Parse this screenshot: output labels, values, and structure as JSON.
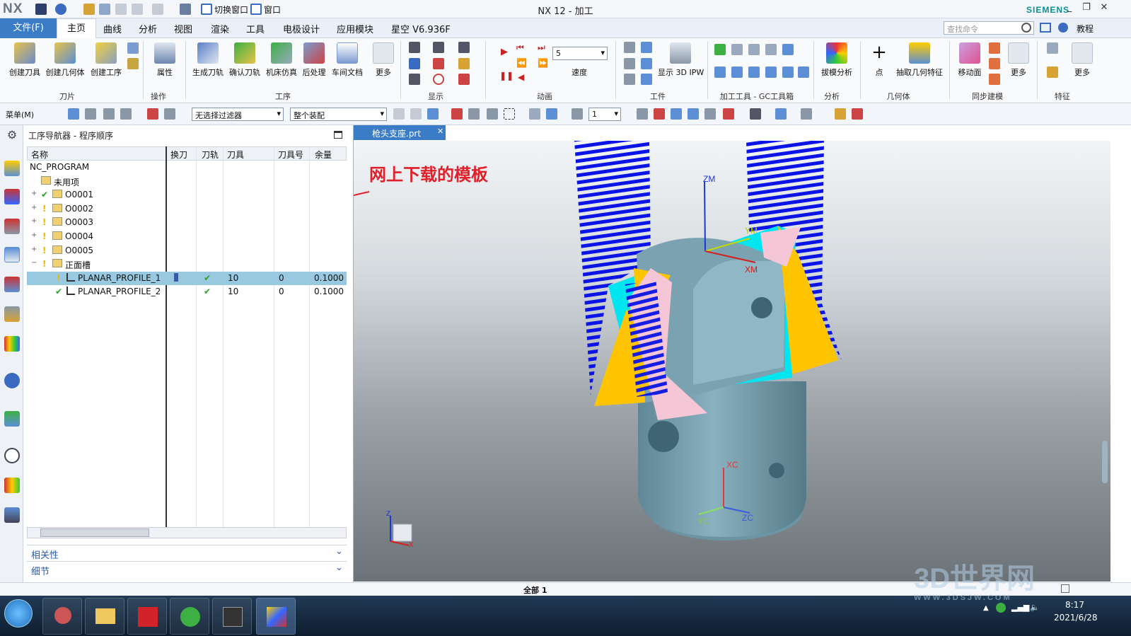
{
  "title_bar": {
    "logo": "NX",
    "switch_window": "切换窗口",
    "window_menu": "窗口",
    "app_title": "NX 12 - 加工",
    "brand": "SIEMENS"
  },
  "menu": {
    "file": "文件(F)",
    "tabs": [
      "主页",
      "曲线",
      "分析",
      "视图",
      "渲染",
      "工具",
      "电极设计",
      "应用模块",
      "星空 V6.936F"
    ],
    "search_placeholder": "查找命令",
    "tutorial": "教程"
  },
  "ribbon": {
    "buttons": [
      "创建刀具",
      "创建几何体",
      "创建工序",
      "属性",
      "生成刀轨",
      "确认刀轨",
      "机床仿真",
      "后处理",
      "车间文档",
      "更多",
      "速度",
      "显示 3D IPW",
      "拔模分析",
      "点",
      "抽取几何特征",
      "移动面",
      "更多",
      "更多"
    ],
    "groups": [
      "刀片",
      "操作",
      "工序",
      "显示",
      "动画",
      "工件",
      "加工工具 - GC工具箱",
      "分析",
      "几何体",
      "同步建模",
      "特征"
    ],
    "speed_value": "5"
  },
  "toolbar2": {
    "menu": "菜单(M)",
    "filter": "无选择过滤器",
    "assembly": "整个装配",
    "layer_value": "1"
  },
  "navigator": {
    "title": "工序导航器 - 程序顺序",
    "columns": [
      "名称",
      "换刀",
      "刀轨",
      "刀具",
      "刀具号",
      "余量"
    ],
    "rows": [
      {
        "name": "NC_PROGRAM",
        "change": "",
        "path": "",
        "tool": "",
        "tool_no": "",
        "stock": ""
      },
      {
        "name": "未用项",
        "change": "",
        "path": "",
        "tool": "",
        "tool_no": "",
        "stock": ""
      },
      {
        "name": "O0001",
        "change": "",
        "path": "",
        "tool": "",
        "tool_no": "",
        "stock": ""
      },
      {
        "name": "O0002",
        "change": "",
        "path": "",
        "tool": "",
        "tool_no": "",
        "stock": ""
      },
      {
        "name": "O0003",
        "change": "",
        "path": "",
        "tool": "",
        "tool_no": "",
        "stock": ""
      },
      {
        "name": "O0004",
        "change": "",
        "path": "",
        "tool": "",
        "tool_no": "",
        "stock": ""
      },
      {
        "name": "O0005",
        "change": "",
        "path": "",
        "tool": "",
        "tool_no": "",
        "stock": ""
      },
      {
        "name": "正面槽",
        "change": "",
        "path": "",
        "tool": "",
        "tool_no": "",
        "stock": ""
      },
      {
        "name": "PLANAR_PROFILE_1",
        "change": "",
        "path": "✔",
        "tool": "10",
        "tool_no": "0",
        "stock": "0.1000"
      },
      {
        "name": "PLANAR_PROFILE_2",
        "change": "",
        "path": "✔",
        "tool": "10",
        "tool_no": "0",
        "stock": "0.1000"
      }
    ],
    "sections": [
      "相关性",
      "细节"
    ]
  },
  "viewport": {
    "tab": "枪头支座.prt",
    "annotation": "网上下载的模板",
    "axes": {
      "zm": "ZM",
      "ym": "YM",
      "xm": "XM",
      "xc": "XC",
      "yc": "YC",
      "zc": "ZC",
      "z": "Z",
      "x": "X"
    }
  },
  "status": {
    "text": "全部 1"
  },
  "taskbar": {
    "time": "8:17",
    "date": "2021/6/28"
  },
  "watermark": {
    "text": "3D世界网",
    "url": "WWW.3DSJW.COM"
  },
  "colors": {
    "accent": "#3a7cc6",
    "annotation": "#e0202a",
    "cyan": "#00e5f0",
    "blue": "#0a14e6",
    "yellow": "#ffc400",
    "pink": "#f5c6d6",
    "part": "#7fa6b4"
  }
}
